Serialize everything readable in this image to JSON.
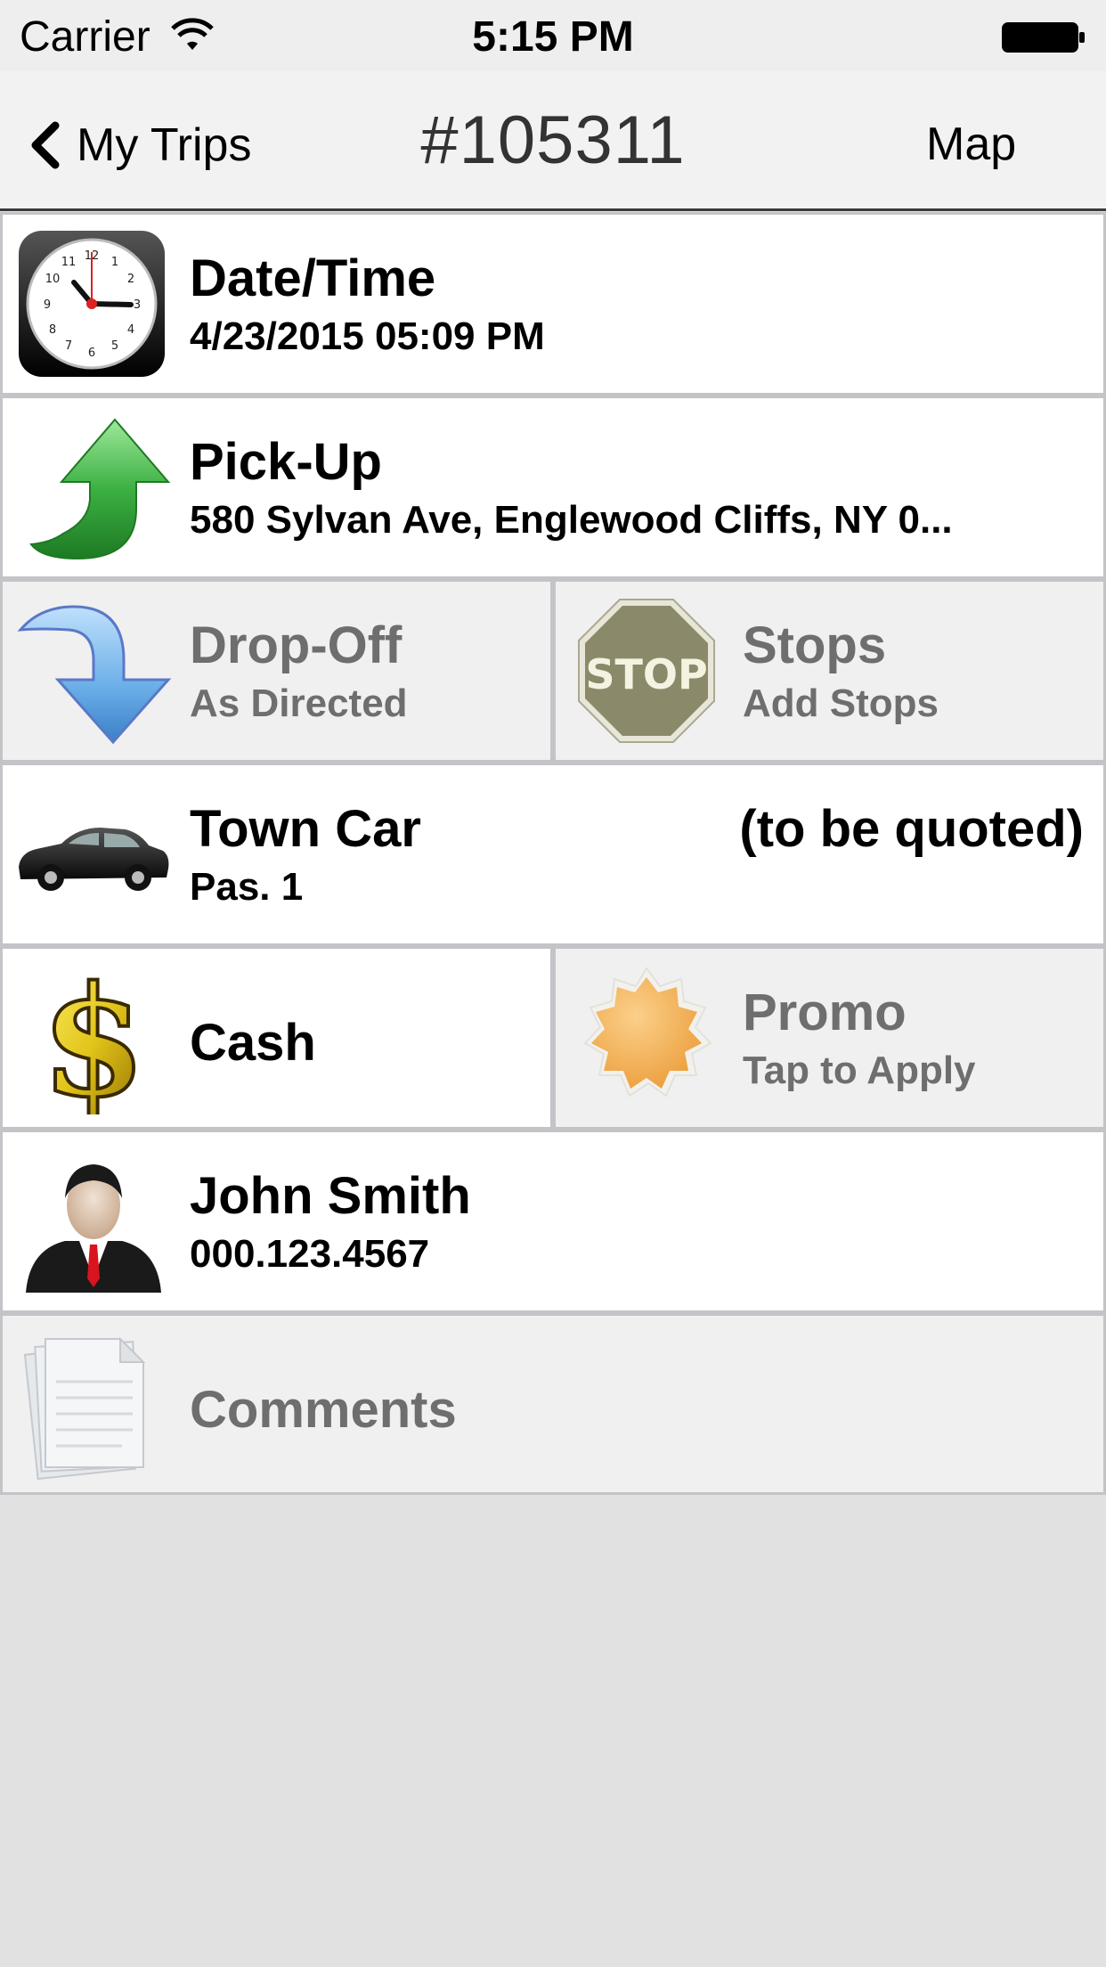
{
  "status_bar": {
    "carrier": "Carrier",
    "time": "5:15 PM"
  },
  "nav": {
    "back_label": "My Trips",
    "title": "#105311",
    "map_label": "Map"
  },
  "rows": {
    "datetime": {
      "title": "Date/Time",
      "value": "4/23/2015 05:09 PM",
      "icon": "clock-icon"
    },
    "pickup": {
      "title": "Pick-Up",
      "value": "580 Sylvan Ave, Englewood Cliffs, NY 0...",
      "icon": "green-arrow-up-icon"
    },
    "dropoff": {
      "title": "Drop-Off",
      "value": "As Directed",
      "icon": "blue-arrow-down-icon"
    },
    "stops": {
      "title": "Stops",
      "value": "Add Stops",
      "icon": "stop-sign-icon",
      "sign_text": "STOP"
    },
    "vehicle": {
      "title": "Town Car",
      "value": "Pas. 1",
      "price": "(to be quoted)",
      "icon": "car-icon"
    },
    "payment": {
      "title": "Cash",
      "icon": "dollar-icon"
    },
    "promo": {
      "title": "Promo",
      "value": "Tap to Apply",
      "icon": "promo-badge-icon"
    },
    "passenger": {
      "title": "John Smith",
      "value": "000.123.4567",
      "icon": "person-icon"
    },
    "comments": {
      "title": "Comments",
      "icon": "document-icon"
    }
  },
  "colors": {
    "background": "#e1e1e1",
    "cell_white": "#ffffff",
    "cell_grey": "#f0f0f0",
    "pickup_arrow": "#3cb043",
    "dropoff_arrow": "#6aaee8",
    "stop_sign": "#8a8a6a",
    "promo_badge": "#f2b25a"
  }
}
